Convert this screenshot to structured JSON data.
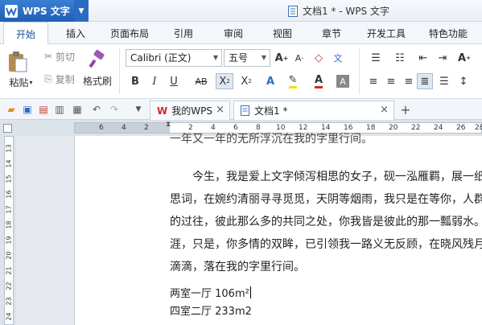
{
  "app": {
    "name": "WPS 文字",
    "window_title": "文档1 * - WPS 文字"
  },
  "ribbon_tabs": [
    "开始",
    "插入",
    "页面布局",
    "引用",
    "审阅",
    "视图",
    "章节",
    "开发工具",
    "特色功能"
  ],
  "ribbon": {
    "paste_label": "粘贴",
    "cut_label": "剪切",
    "copy_label": "复制",
    "format_painter_label": "格式刷",
    "font_name": "Calibri (正文)",
    "font_size": "五号"
  },
  "doc_tabs": [
    {
      "label": "我的WPS"
    },
    {
      "label": "文档1 *"
    }
  ],
  "ruler": {
    "h_numbers": [
      "6",
      "4",
      "2",
      "2",
      "4",
      "6",
      "8",
      "10",
      "12",
      "14",
      "16",
      "18",
      "20",
      "22",
      "24",
      "26",
      "28"
    ],
    "v_numbers": [
      "13",
      "14",
      "15",
      "16",
      "17",
      "18",
      "19",
      "20",
      "21",
      "22",
      "23",
      "24"
    ]
  },
  "document": {
    "lines": [
      "一年又一年的无所浮沉在我的字里行间。",
      "　　今生，我是爱上文字倾泻相思的女子，砚一泓雁羁，展一纸",
      "思词，在婉约清丽寻寻觅觅，天阴等烟雨，我只是在等你，人群",
      "的过往，彼此那么多的共同之处，你我皆是彼此的那一瓢弱水。",
      "涯，只是，你多情的双眸，已引领我一路义无反顾，在晓风残月",
      "滴滴，落在我的字里行间。",
      "两室一厅 106m²",
      "四室二厅 233m2"
    ]
  },
  "colors": {
    "accent": "#2a6cc2",
    "active_tab_text": "#1a4fa0",
    "wps_red": "#d9262b"
  }
}
